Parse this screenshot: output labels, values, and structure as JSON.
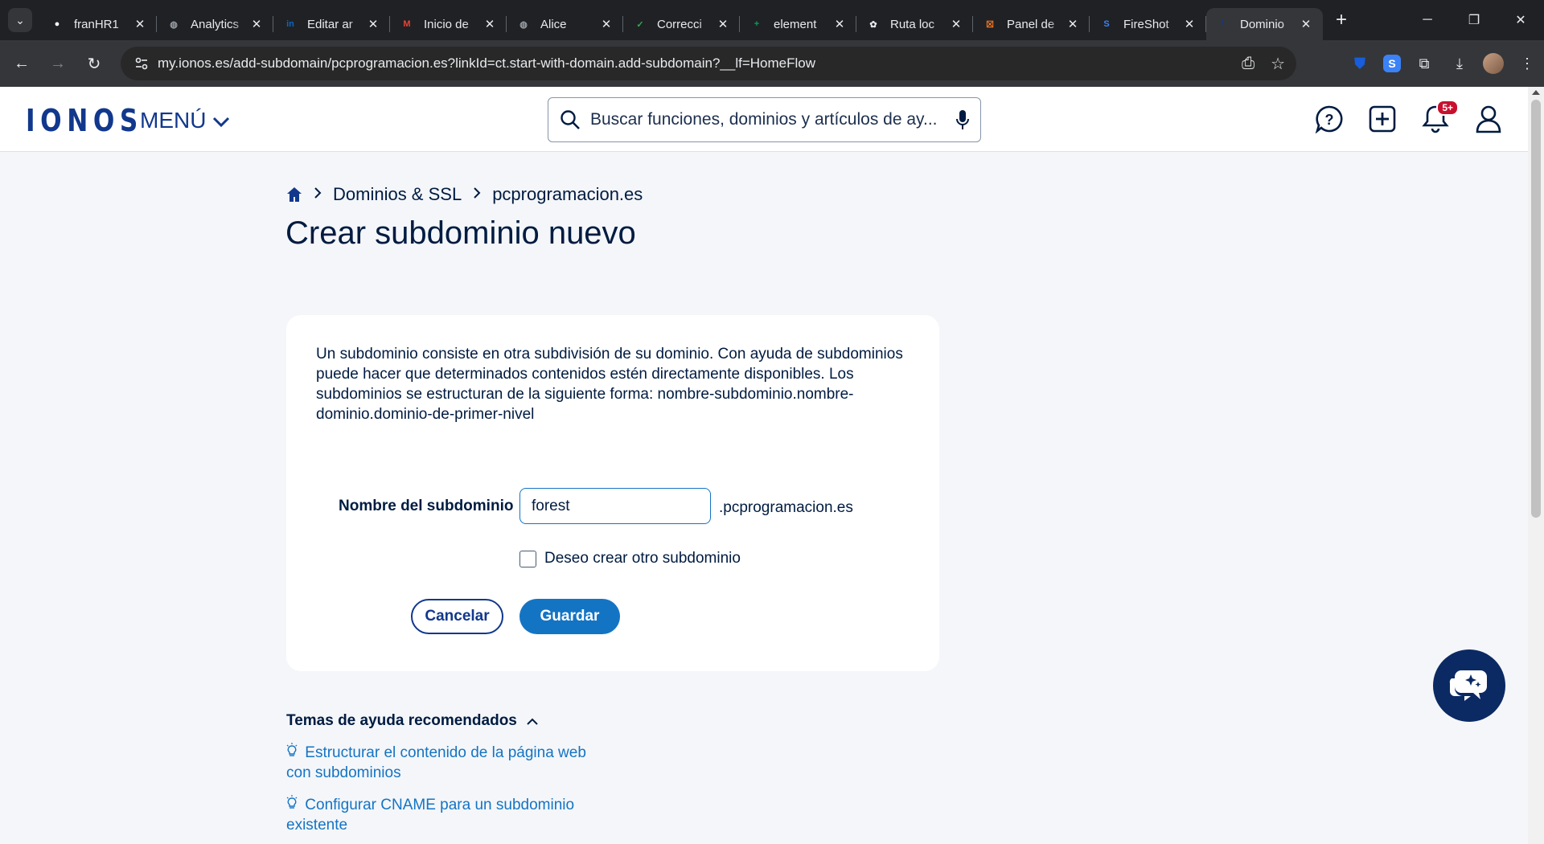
{
  "browser": {
    "tabs": [
      {
        "title": "franHR1",
        "favicon": "github-icon",
        "color": "#ffffff"
      },
      {
        "title": "Analytics",
        "favicon": "globe-icon",
        "color": "#9aa0a6"
      },
      {
        "title": "Editar ar",
        "favicon": "linkedin-icon",
        "color": "#0a66c2"
      },
      {
        "title": "Inicio de",
        "favicon": "gmail-icon",
        "color": "#ea4335"
      },
      {
        "title": "Alice",
        "favicon": "globe-icon",
        "color": "#9aa0a6"
      },
      {
        "title": "Correcci",
        "favicon": "check-icon",
        "color": "#34a853"
      },
      {
        "title": "element",
        "favicon": "sheets-icon",
        "color": "#0f9d58"
      },
      {
        "title": "Ruta loc",
        "favicon": "openai-icon",
        "color": "#e8eaed"
      },
      {
        "title": "Panel de",
        "favicon": "xampp-icon",
        "color": "#fb7a24"
      },
      {
        "title": "FireShot",
        "favicon": "fireshot-icon",
        "color": "#3b82f6"
      },
      {
        "title": "Dominio",
        "favicon": "ionos-icon",
        "color": "#11388c",
        "active": true
      }
    ],
    "url": "my.ionos.es/add-subdomain/pcprogramacion.es?linkId=ct.start-with-domain.add-subdomain?__lf=HomeFlow"
  },
  "header": {
    "logo": "IONOS",
    "menu_label": "MENÚ",
    "search_placeholder": "Buscar funciones, dominios y artículos de ay...",
    "notification_badge": "5+"
  },
  "breadcrumb": {
    "items": [
      "Dominios & SSL",
      "pcprogramacion.es"
    ]
  },
  "page_title": "Crear subdominio nuevo",
  "form": {
    "description": "Un subdominio consiste en otra subdivisión de su dominio. Con ayuda de subdominios puede hacer que determinados contenidos estén directamente disponibles. Los subdominios se estructuran de la siguiente forma: nombre-subdominio.nombre-dominio.dominio-de-primer-nivel",
    "field_label": "Nombre del subdominio",
    "field_value": "forest",
    "domain_suffix": ".pcprogramacion.es",
    "checkbox_label": "Deseo crear otro subdominio",
    "checkbox_checked": false,
    "cancel_label": "Cancelar",
    "save_label": "Guardar"
  },
  "help": {
    "heading": "Temas de ayuda recomendados",
    "links": [
      "Estructurar el contenido de la página web con subdominios",
      "Configurar CNAME para un subdominio existente"
    ]
  },
  "colors": {
    "brand": "#11388c",
    "accent": "#1474c4",
    "text": "#001b41"
  }
}
